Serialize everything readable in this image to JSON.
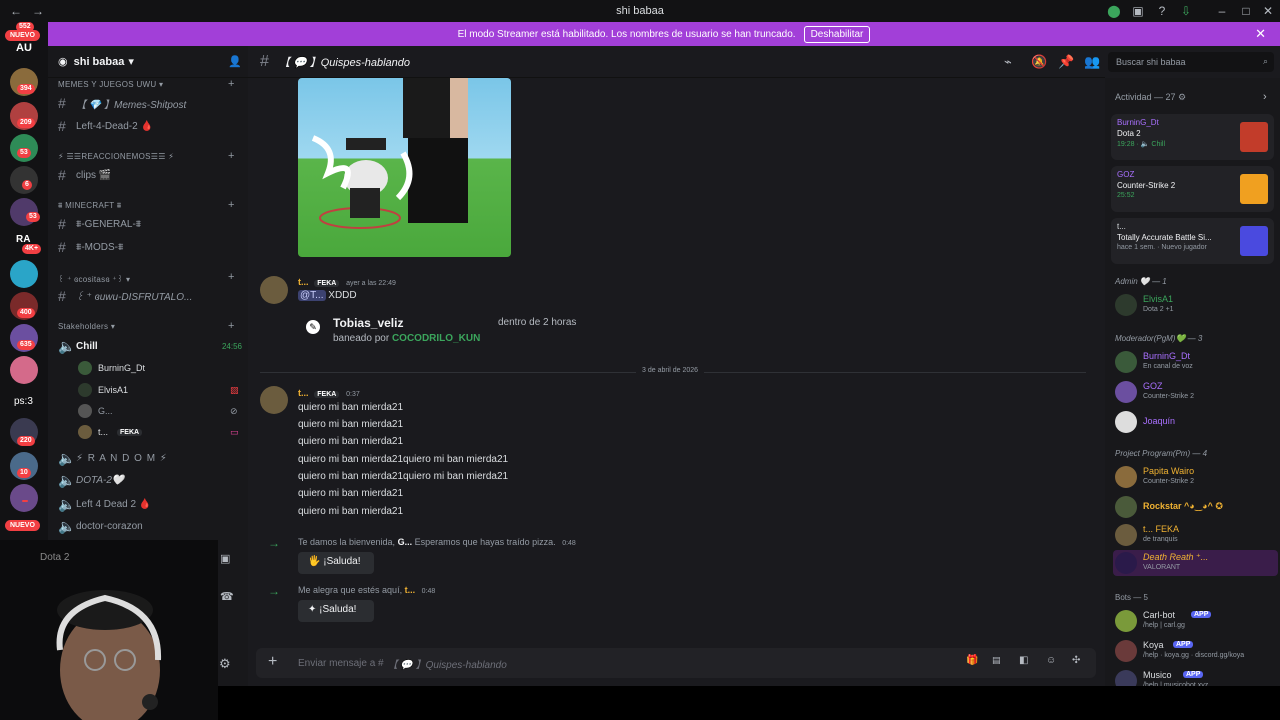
{
  "titlebar": {
    "title": "shi babaa"
  },
  "rail": {
    "top_badge": "552",
    "new_label": "NUEVO",
    "au_label": "AU",
    "badges": [
      "394",
      "209",
      "53",
      "6",
      "53",
      "4K+",
      "400",
      "635",
      "220",
      "10"
    ],
    "ra_label": "RA",
    "ps_label": "ps:3",
    "new_label_2": "NUEVO"
  },
  "banner": {
    "text": "El modo Streamer está habilitado. Los nombres de usuario se han truncado.",
    "button": "Deshabilitar"
  },
  "sidebar": {
    "server_name": "shi babaa",
    "categories": [
      "MEMES Y JUEGOS UWU",
      "⚡ ☰☰REACCIONEMOS☰☰ ⚡",
      "⩩ MINECRAFT ⩩",
      "꒰ ⁺ ɞcositasɞ ⁺꒱",
      "Stakeholders"
    ],
    "channels": [
      "【 💎 】Memes-Shitpost",
      "Left-4-Dead-2 🩸",
      "clips 🎬",
      "⩩-GENERAL-⩩",
      "⩩-MODS-⩩",
      "꒰ ⁺ ɞuwu-DISFRUTALO..."
    ],
    "voice_channel": "Chill",
    "voice_timer": "24:56",
    "voice_users": [
      "BurninG_Dt",
      "ElvisA1",
      "G...",
      "t..."
    ],
    "voice_user_tag": "FEKA",
    "other_voice": [
      "⚡ R A N D O M ⚡",
      "DOTA-2🤍",
      "Left 4 Dead 2 🩸",
      "doctor-corazon"
    ]
  },
  "header": {
    "channel_name": "【 💬 】Quispes-hablando",
    "search_placeholder": "Buscar shi babaa"
  },
  "messages": {
    "msg1": {
      "user": "t...",
      "tag": "FEKA",
      "time": "ayer a las 22:49",
      "mention": "@T...",
      "text": "XDDD"
    },
    "ban": {
      "user": "Tobias_veliz",
      "when": "dentro de 2 horas",
      "by_prefix": "baneado por",
      "by": "COCODRILO_KUN"
    },
    "date_divider": "3 de abril de 2026",
    "msg2": {
      "user": "t...",
      "tag": "FEKA",
      "time": "0:37"
    },
    "lines": [
      "quiero mi ban mierda21",
      "quiero mi ban mierda21",
      "quiero mi ban mierda21",
      "quiero mi ban mierda21quiero mi ban mierda21",
      "quiero mi ban mierda21quiero mi ban mierda21",
      "quiero mi ban mierda21",
      "quiero mi ban mierda21"
    ],
    "welcome1": {
      "pre": "Te damos la bienvenida,",
      "user": "G...",
      "post": "Esperamos que hayas traído pizza.",
      "time": "0:48",
      "button": "¡Saluda!"
    },
    "welcome2": {
      "pre": "Me alegra que estés aquí,",
      "user": "t...",
      "time": "0:48",
      "button": "¡Saluda!"
    }
  },
  "composer": {
    "placeholder_prefix": "Enviar mensaje a #",
    "placeholder_channel": "【 💬 】Quispes-hablando"
  },
  "members": {
    "activity_header": "Actividad — 27",
    "activities": [
      {
        "user": "BurninG_Dt",
        "game": "Dota 2",
        "status": "19:28 · 🔈 Chill",
        "color": "#c23c2a"
      },
      {
        "user": "GOZ",
        "game": "Counter-Strike 2",
        "status": "25:52",
        "color": "#f0a020"
      },
      {
        "user": "t...",
        "game": "Totally Accurate Battle Si...",
        "status": "hace 1 sem. · Nuevo jugador",
        "color": "#4a4adf"
      }
    ],
    "groups": [
      {
        "title": "Admin 🤍 — 1",
        "members": [
          {
            "name": "ElvisA1",
            "sub": "Dota 2 +1",
            "color": "#3ba55c"
          }
        ]
      },
      {
        "title": "Moderador(PgM)💚 — 3",
        "members": [
          {
            "name": "BurninG_Dt",
            "sub": "En canal de voz",
            "color": "#a970ff"
          },
          {
            "name": "GOZ",
            "sub": "Counter-Strike 2",
            "color": "#a970ff"
          },
          {
            "name": "Joaquín",
            "sub": "",
            "color": "#a970ff"
          }
        ]
      },
      {
        "title": "Project Program(Pm) — 4",
        "members": [
          {
            "name": "Papita Wairo",
            "sub": "Counter-Strike 2",
            "color": "#f0b232"
          },
          {
            "name": "Rockstar ^◕‿◕^ ✪",
            "sub": "",
            "color": "#f0b232"
          },
          {
            "name": "t... FEKA",
            "sub": "de tranquis",
            "color": "#f0b232"
          },
          {
            "name": "Death Reath ⁺...",
            "sub": "VALORANT",
            "color": "#f0b232"
          }
        ]
      },
      {
        "title": "Bots — 5",
        "members": [
          {
            "name": "Carl-bot",
            "sub": "/help | carl.gg",
            "color": "#dbdee1"
          },
          {
            "name": "Koya",
            "sub": "/help · koya.gg · discord.gg/koya",
            "color": "#dbdee1"
          },
          {
            "name": "Musico",
            "sub": "/help | musicobot.xyz",
            "color": "#dbdee1"
          }
        ]
      }
    ],
    "app_tag": "APP"
  },
  "webcam": {
    "partial_label": "Dota 2"
  }
}
